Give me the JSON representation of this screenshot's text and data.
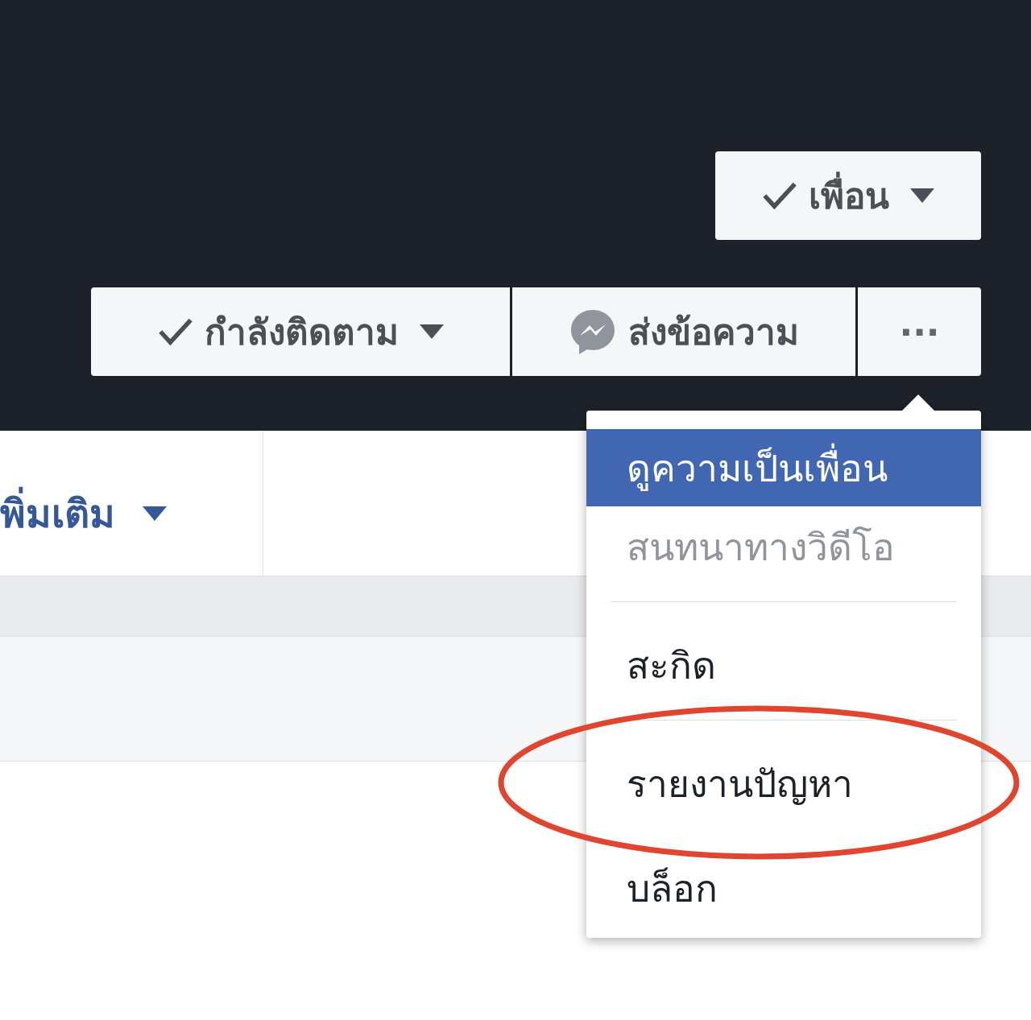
{
  "cover": {
    "friend_button": {
      "label": "เพื่อน"
    },
    "actions": [
      {
        "kind": "follow",
        "label": "กำลังติดตาม"
      },
      {
        "kind": "message",
        "label": "ส่งข้อความ"
      },
      {
        "kind": "more",
        "label": "···"
      }
    ]
  },
  "tabs": [
    {
      "label": "พิ่มเติม"
    }
  ],
  "menu": {
    "items": [
      {
        "kind": "item",
        "label": "ดูความเป็นเพื่อน",
        "selected": true,
        "disabled": false
      },
      {
        "kind": "item",
        "label": "สนทนาทางวิดีโอ",
        "selected": false,
        "disabled": true
      },
      {
        "kind": "separator"
      },
      {
        "kind": "item",
        "label": "สะกิด",
        "selected": false,
        "disabled": false
      },
      {
        "kind": "separator"
      },
      {
        "kind": "item",
        "label": "รายงานปัญหา",
        "selected": false,
        "disabled": false
      },
      {
        "kind": "item",
        "label": "บล็อก",
        "selected": false,
        "disabled": false
      }
    ]
  }
}
